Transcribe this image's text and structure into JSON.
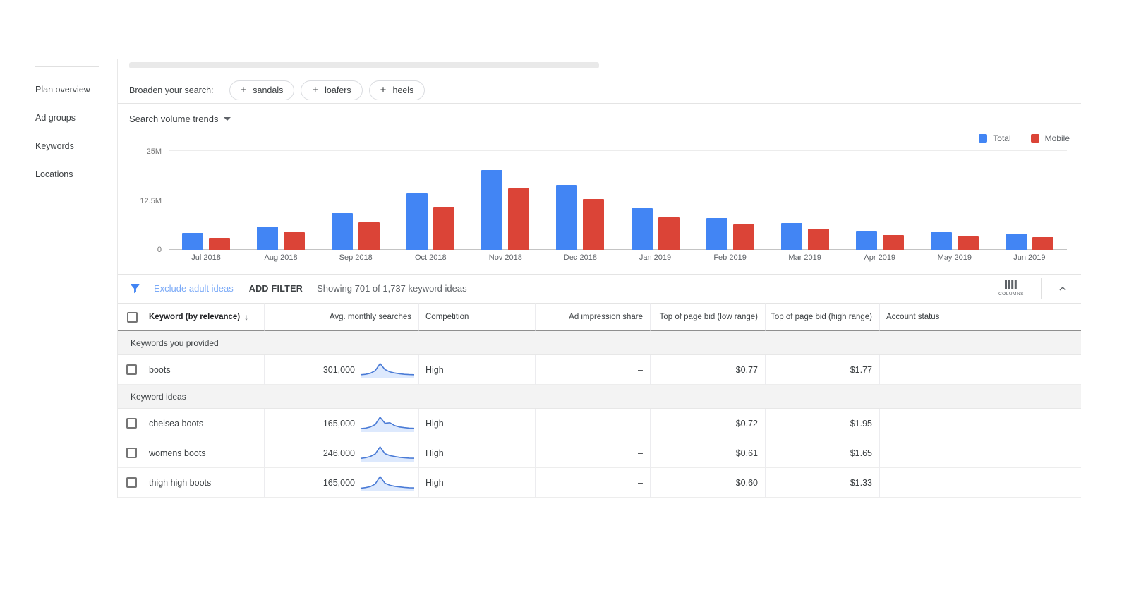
{
  "sidebar": {
    "items": [
      {
        "label": "Plan overview"
      },
      {
        "label": "Ad groups"
      },
      {
        "label": "Keywords"
      },
      {
        "label": "Locations"
      }
    ]
  },
  "broaden": {
    "label": "Broaden your search:",
    "chips": [
      "sandals",
      "loafers",
      "heels"
    ]
  },
  "chart_data": {
    "type": "bar",
    "title": "Search volume trends",
    "unit": "millions of searches",
    "categories": [
      "Jul 2018",
      "Aug 2018",
      "Sep 2018",
      "Oct 2018",
      "Nov 2018",
      "Dec 2018",
      "Jan 2019",
      "Feb 2019",
      "Mar 2019",
      "Apr 2019",
      "May 2019",
      "Jun 2019"
    ],
    "series": [
      {
        "name": "Total",
        "color": "#4285F4",
        "values": [
          4.3,
          5.9,
          9.2,
          14.3,
          20.1,
          16.4,
          10.5,
          8.1,
          6.8,
          4.8,
          4.5,
          4.1
        ]
      },
      {
        "name": "Mobile",
        "color": "#DB4437",
        "values": [
          3.0,
          4.4,
          7.0,
          10.9,
          15.6,
          12.8,
          8.2,
          6.4,
          5.3,
          3.8,
          3.4,
          3.2
        ]
      }
    ],
    "ylim": [
      0,
      25
    ],
    "yticks": [
      "0",
      "12.5M",
      "25M"
    ],
    "grid": "horizontal",
    "legend_position": "top-right"
  },
  "filterbar": {
    "exclude_link": "Exclude adult ideas",
    "add_filter": "ADD FILTER",
    "showing": "Showing 701 of 1,737 keyword ideas",
    "columns_caption": "COLUMNS"
  },
  "table": {
    "headers": {
      "keyword": "Keyword (by relevance)",
      "avg": "Avg. monthly searches",
      "competition": "Competition",
      "ad_impression": "Ad impression share",
      "bid_low": "Top of page bid (low range)",
      "bid_high": "Top of page bid (high range)",
      "account_status": "Account status"
    },
    "sections": [
      {
        "label": "Keywords you provided",
        "rows": [
          {
            "keyword": "boots",
            "avg": "301,000",
            "competition": "High",
            "ad_impression": "–",
            "bid_low": "$0.77",
            "bid_high": "$1.77",
            "account_status": "",
            "trend": [
              1.5,
              1.8,
              2.5,
              4.2,
              9.0,
              5.0,
              3.4,
              2.7,
              2.2,
              1.8,
              1.6,
              1.5
            ]
          }
        ]
      },
      {
        "label": "Keyword ideas",
        "rows": [
          {
            "keyword": "chelsea boots",
            "avg": "165,000",
            "competition": "High",
            "ad_impression": "–",
            "bid_low": "$0.72",
            "bid_high": "$1.95",
            "account_status": "",
            "trend": [
              1.2,
              1.5,
              2.2,
              3.6,
              8.0,
              4.4,
              4.7,
              3.0,
              2.2,
              1.8,
              1.5,
              1.4
            ]
          },
          {
            "keyword": "womens boots",
            "avg": "246,000",
            "competition": "High",
            "ad_impression": "–",
            "bid_low": "$0.61",
            "bid_high": "$1.65",
            "account_status": "",
            "trend": [
              1.2,
              1.6,
              2.4,
              4.0,
              8.5,
              4.2,
              3.0,
              2.4,
              1.9,
              1.6,
              1.4,
              1.3
            ]
          },
          {
            "keyword": "thigh high boots",
            "avg": "165,000",
            "competition": "High",
            "ad_impression": "–",
            "bid_low": "$0.60",
            "bid_high": "$1.33",
            "account_status": "",
            "trend": [
              1.0,
              1.4,
              2.0,
              3.5,
              8.0,
              4.0,
              2.8,
              2.2,
              1.8,
              1.5,
              1.3,
              1.2
            ]
          }
        ]
      }
    ]
  },
  "colors": {
    "total_bar": "#4285F4",
    "mobile_bar": "#DB4437",
    "link_blue": "#7baaf7",
    "spark_line": "#4a7bd6"
  }
}
